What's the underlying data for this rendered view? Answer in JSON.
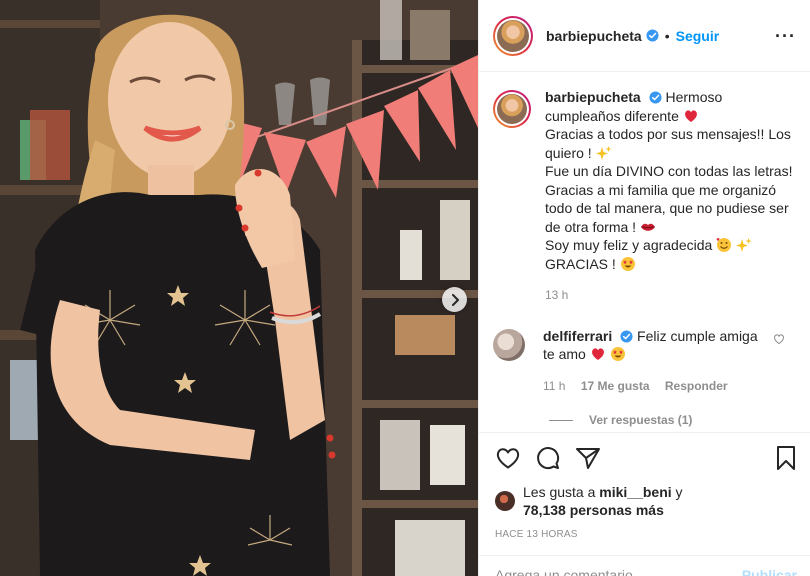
{
  "post": {
    "username": "barbiepucheta",
    "follow_label": "Seguir",
    "separator": "•",
    "more_label": "···"
  },
  "caption": {
    "username": "barbiepucheta",
    "lines": [
      "Hermoso cumpleaños diferente",
      "Gracias a todos por sus mensajes!! Los quiero !",
      "Fue un día DIVINO con todas las letras! Gracias a mi familia que me organizó todo de tal manera, que no pudiese ser de otra forma !",
      "Soy muy feliz y agradecida",
      "GRACIAS !"
    ],
    "time": "13 h"
  },
  "comment": {
    "username": "delfiferrari",
    "text": "Feliz cumple amiga te amo",
    "time": "11 h",
    "likes": "17 Me gusta",
    "reply_label": "Responder",
    "view_replies": "Ver respuestas (1)"
  },
  "likes": {
    "prefix": "Les gusta a",
    "user": "miki__beni",
    "conjunction": "y",
    "others": "78,138 personas más"
  },
  "posted_ago": "HACE 13 HORAS",
  "comment_input": {
    "placeholder": "Agrega un comentario..."
  },
  "publish_label": "Publicar",
  "icons": {
    "verified": "verified-badge-icon",
    "like": "heart-outline-icon",
    "comment": "comment-bubble-icon",
    "share": "paper-plane-icon",
    "save": "bookmark-icon",
    "next": "chevron-right-icon"
  },
  "colors": {
    "accent": "#0095f6",
    "verified": "#3897f0",
    "muted": "#8e8e8e",
    "heart": "#ed4956"
  }
}
